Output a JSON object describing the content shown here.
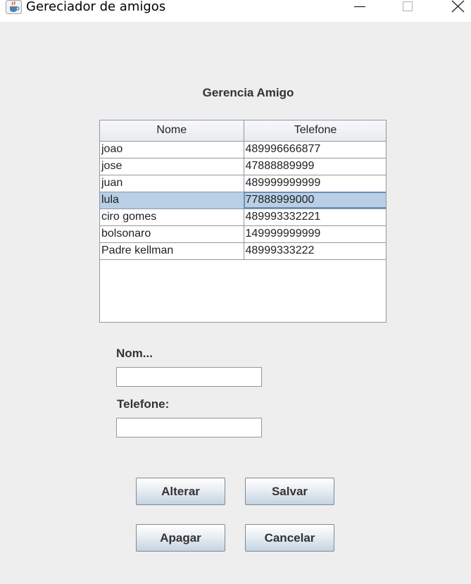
{
  "window": {
    "title": "Gereciador de amigos",
    "app_icon": "java-cup-icon",
    "controls": [
      "minimize-icon",
      "maximize-icon",
      "close-icon"
    ]
  },
  "form": {
    "heading": "Gerencia Amigo",
    "table": {
      "columns": [
        "Nome",
        "Telefone"
      ],
      "rows": [
        {
          "nome": "joao",
          "telefone": "489996666877"
        },
        {
          "nome": "jose",
          "telefone": "47888889999"
        },
        {
          "nome": "juan",
          "telefone": "489999999999"
        },
        {
          "nome": "lula",
          "telefone": "77888999000"
        },
        {
          "nome": "ciro gomes",
          "telefone": "489993332221"
        },
        {
          "nome": "bolsonaro",
          "telefone": "149999999999"
        },
        {
          "nome": "Padre kellman",
          "telefone": "48999333222"
        }
      ],
      "selected_row": 3
    },
    "nome_label": "Nom...",
    "nome_value": "",
    "telefone_label": "Telefone:",
    "telefone_value": "",
    "buttons": {
      "alterar": "Alterar",
      "salvar": "Salvar",
      "apagar": "Apagar",
      "cancelar": "Cancelar"
    }
  },
  "colors": {
    "window_bg": "#eeeeee",
    "selection_bg": "#b8cfe5",
    "grid_line": "#8f98a3"
  }
}
